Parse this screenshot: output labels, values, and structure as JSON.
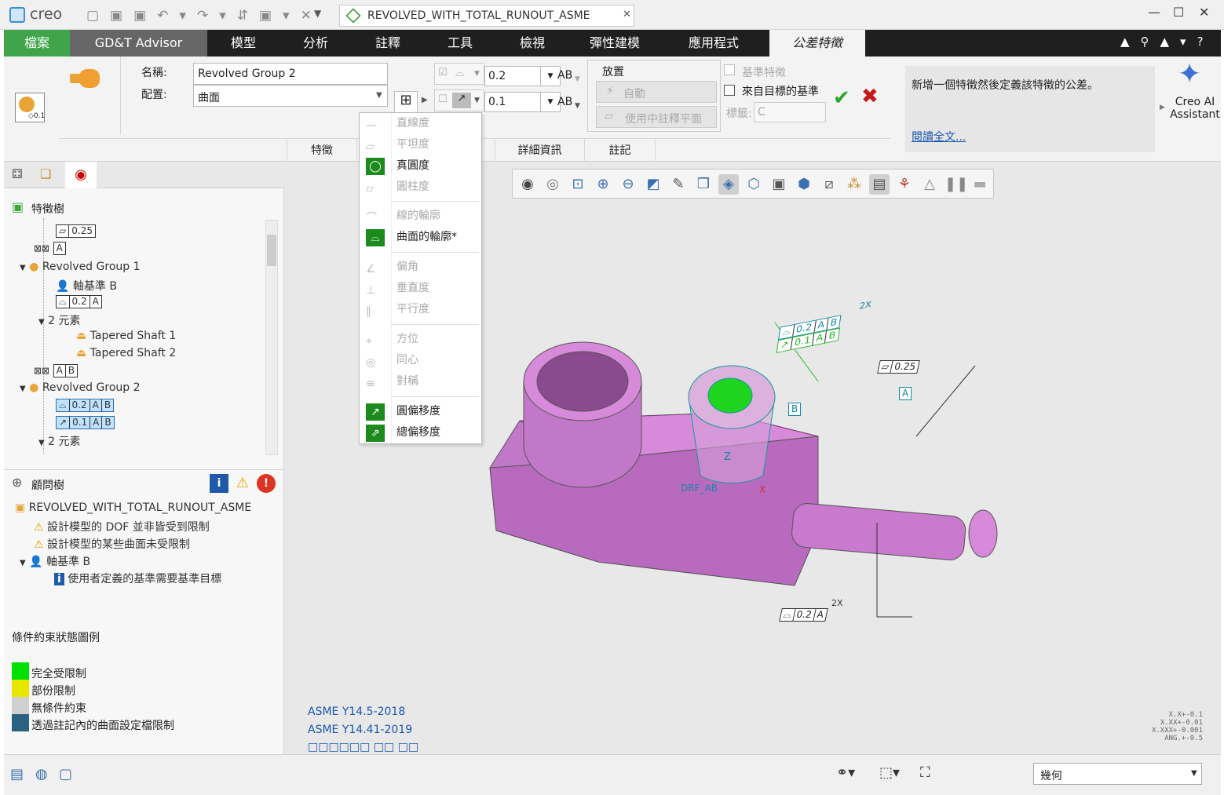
{
  "app": {
    "logo": "creo",
    "doc_tab": "REVOLVED_WITH_TOTAL_RUNOUT_ASME"
  },
  "menubar": {
    "items": [
      "檔案",
      "GD&T Advisor",
      "模型",
      "分析",
      "註釋",
      "工具",
      "檢視",
      "彈性建模",
      "應用程式",
      "公差特徵"
    ]
  },
  "ribbon": {
    "name_label": "名稱:",
    "name_value": "Revolved Group 2",
    "config_label": "配置:",
    "config_value": "曲面",
    "tol1": "0.2",
    "tol2": "0.1",
    "ab1": "AB",
    "ab2": "AB",
    "placement_title": "放置",
    "auto_btn": "自動",
    "use_plane_btn": "使用中註釋平面",
    "datum_feature": "基準特徵",
    "from_target": "來自目標的基準",
    "label_lbl": "標籤:",
    "label_value": "C",
    "tabs": [
      "特徵",
      "詳細資訊",
      "註記"
    ],
    "help_text": "新增一個特徵然後定義該特徵的公差。",
    "read_more": "閱讀全文...",
    "ai_assistant_line1": "Creo AI",
    "ai_assistant_line2": "Assistant"
  },
  "dropdown": {
    "items": [
      {
        "label": "直線度",
        "enabled": false
      },
      {
        "label": "平坦度",
        "enabled": false
      },
      {
        "label": "真圓度",
        "enabled": true
      },
      {
        "label": "圓柱度",
        "enabled": false
      },
      {
        "label": "線的輪廓",
        "enabled": false
      },
      {
        "label": "曲面的輪廓*",
        "enabled": true
      },
      {
        "label": "偏角",
        "enabled": false
      },
      {
        "label": "垂直度",
        "enabled": false
      },
      {
        "label": "平行度",
        "enabled": false
      },
      {
        "label": "方位",
        "enabled": false
      },
      {
        "label": "同心",
        "enabled": false
      },
      {
        "label": "對稱",
        "enabled": false
      },
      {
        "label": "圓偏移度",
        "enabled": true
      },
      {
        "label": "總偏移度",
        "enabled": true
      }
    ]
  },
  "tree": {
    "title": "特徵樹",
    "rows": {
      "fcf025": "0.25",
      "datumA": "A",
      "rg1": "Revolved Group 1",
      "axisB": "軸基準 B",
      "fcf02": "0.2",
      "fcfA": "A",
      "elems": "2 元素",
      "ts1": "Tapered Shaft 1",
      "ts2": "Tapered Shaft 2",
      "dA": "A",
      "dB": "B",
      "rg2": "Revolved Group 2",
      "f1v": "0.2",
      "f2v": "0.1",
      "elems2": "2 元素"
    }
  },
  "advisor": {
    "title": "顧問樹",
    "root": "REVOLVED_WITH_TOTAL_RUNOUT_ASME",
    "msg1": "設計模型的 DOF 並非皆受到限制",
    "msg2": "設計模型的某些曲面未受限制",
    "axis": "軸基準 B",
    "msg3": "使用者定義的基準需要基準目標"
  },
  "legend": {
    "title": "條件約束狀態圖例",
    "items": [
      {
        "label": "完全受限制",
        "color": "#00e000"
      },
      {
        "label": "部份限制",
        "color": "#e6e600"
      },
      {
        "label": "無條件約束",
        "color": "#d0d0d0"
      },
      {
        "label": "透過註記內的曲面設定檔限制",
        "color": "#2a6080"
      }
    ]
  },
  "viewport": {
    "std1": "ASME Y14.5-2018",
    "std2": "ASME Y14.41-2019",
    "std3": "□□□□□□ □□ □□",
    "tolerances": [
      "X.X+-0.1",
      "X.XX+-0.01",
      "X.XXX+-0.001",
      "ANG.+-0.5"
    ],
    "ann_2x_top": "2X",
    "ann_02": "0.2",
    "ann_01": "0.1",
    "ann_A": "A",
    "ann_B": "B",
    "ann_025": "0.25",
    "ann_datumA": "A",
    "ann_datumB": "B",
    "ann_2x_bot": "2X",
    "ann_02b": "0.2",
    "ann_Ab": "A",
    "drf": "DRF_AB",
    "z": "Z",
    "x": "X"
  },
  "statusbar": {
    "filter": "幾何"
  }
}
